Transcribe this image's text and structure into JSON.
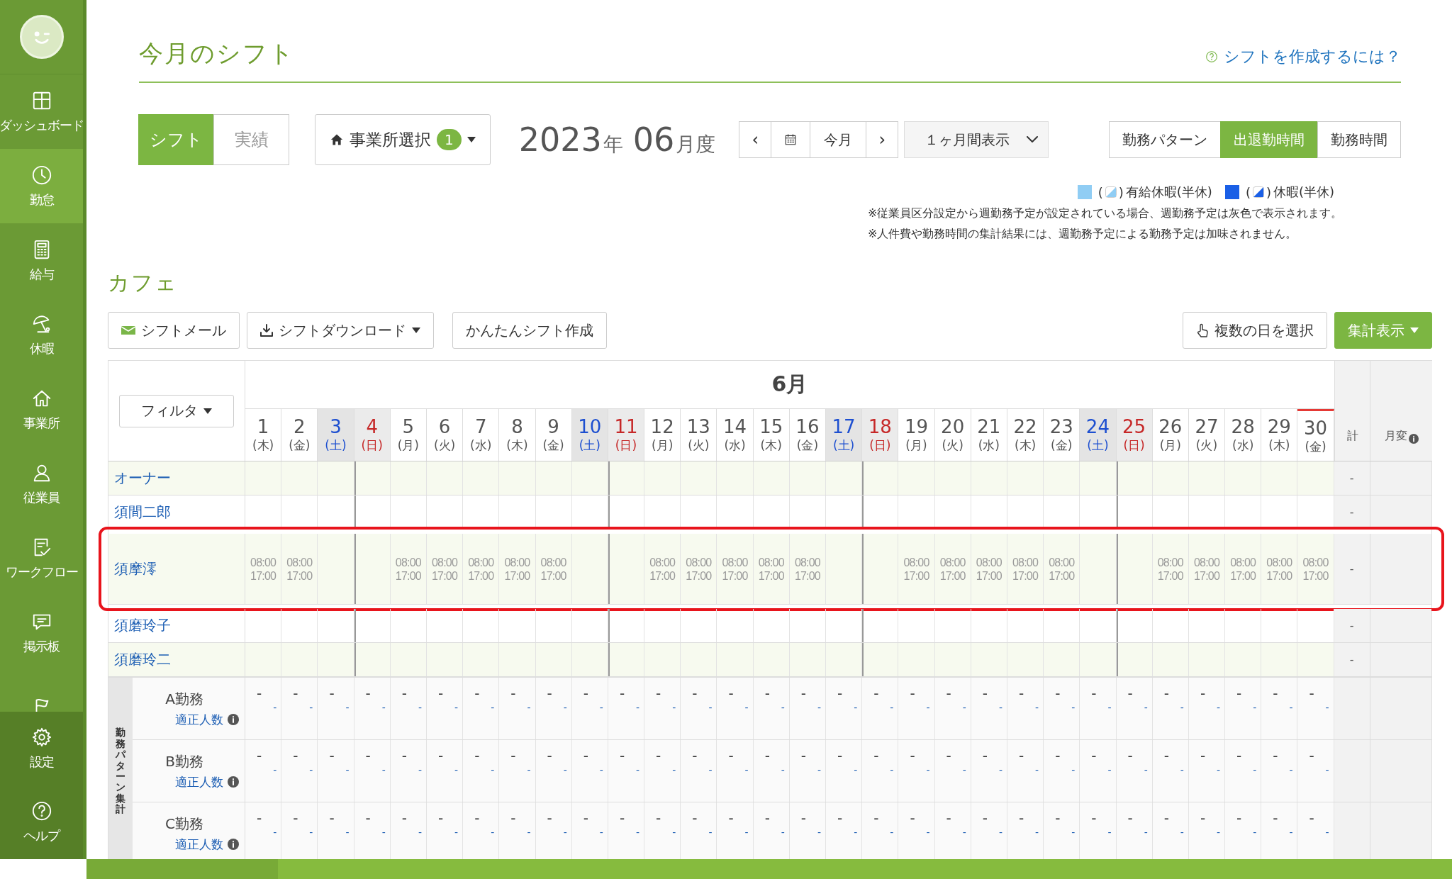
{
  "sidebar": {
    "items": [
      {
        "label": "ダッシュボード",
        "selected": false
      },
      {
        "label": "勤怠",
        "selected": true
      },
      {
        "label": "給与",
        "selected": false
      },
      {
        "label": "休暇",
        "selected": false
      },
      {
        "label": "事業所",
        "selected": false
      },
      {
        "label": "従業員",
        "selected": false
      },
      {
        "label": "ワークフロー",
        "selected": false
      },
      {
        "label": "掲示板",
        "selected": false
      },
      {
        "selected": false
      }
    ],
    "bottom_items": [
      {
        "label": "設定"
      },
      {
        "label": "ヘルプ"
      }
    ]
  },
  "page": {
    "title": "今月のシフト",
    "help_link": "シフトを作成するには？"
  },
  "controls": {
    "mode_tabs": [
      {
        "label": "シフト",
        "selected": true
      },
      {
        "label": "実績",
        "selected": false
      }
    ],
    "office_select": {
      "label": "事業所選択",
      "badge": "1"
    },
    "period": {
      "year": "2023",
      "year_unit": "年",
      "month": "06",
      "month_unit": "月度"
    },
    "nav": {
      "prev": "‹",
      "today": "今月",
      "next": "›"
    },
    "range_select": {
      "value": "１ヶ月間表示"
    },
    "view_tabs": [
      {
        "label": "勤務パターン",
        "selected": false
      },
      {
        "label": "出退勤時間",
        "selected": true
      },
      {
        "label": "勤務時間",
        "selected": false
      }
    ]
  },
  "legend": {
    "items": [
      {
        "color": "#90cdf4",
        "open": "(",
        "close": ")",
        "label": "有給休暇(半休)"
      },
      {
        "color": "#1a5fe6",
        "open": "(",
        "close": ")",
        "label": "休暇(半休)"
      }
    ],
    "notes": [
      "※従業員区分設定から週勤務予定が設定されている場合、週勤務予定は灰色で表示されます。",
      "※人件費や勤務時間の集計結果には、週勤務予定による勤務予定は加味されません。"
    ]
  },
  "section": {
    "title": "カフェ",
    "toolbar": {
      "left": [
        {
          "label": "シフトメール",
          "kind": "mail"
        },
        {
          "label": "シフトダウンロード",
          "kind": "download"
        },
        {
          "label": "かんたんシフト作成",
          "kind": "plain"
        }
      ],
      "right": [
        {
          "label": "複数の日を選択",
          "kind": "hand"
        },
        {
          "label": "集計表示",
          "kind": "primary"
        }
      ]
    }
  },
  "table": {
    "filter": "フィルタ",
    "month": "6月",
    "total_header": "計",
    "change_header": "月変",
    "days": [
      {
        "day": "1",
        "weekday": "(木)",
        "kind": "weekday",
        "today": false
      },
      {
        "day": "2",
        "weekday": "(金)",
        "kind": "weekday",
        "today": false
      },
      {
        "day": "3",
        "weekday": "(土)",
        "kind": "sat",
        "today": false
      },
      {
        "day": "4",
        "weekday": "(日)",
        "kind": "sun",
        "today": false
      },
      {
        "day": "5",
        "weekday": "(月)",
        "kind": "weekday",
        "today": false
      },
      {
        "day": "6",
        "weekday": "(火)",
        "kind": "weekday",
        "today": false
      },
      {
        "day": "7",
        "weekday": "(水)",
        "kind": "weekday",
        "today": false
      },
      {
        "day": "8",
        "weekday": "(木)",
        "kind": "weekday",
        "today": false
      },
      {
        "day": "9",
        "weekday": "(金)",
        "kind": "weekday",
        "today": false
      },
      {
        "day": "10",
        "weekday": "(土)",
        "kind": "sat",
        "today": false
      },
      {
        "day": "11",
        "weekday": "(日)",
        "kind": "sun",
        "today": false
      },
      {
        "day": "12",
        "weekday": "(月)",
        "kind": "weekday",
        "today": false
      },
      {
        "day": "13",
        "weekday": "(火)",
        "kind": "weekday",
        "today": false
      },
      {
        "day": "14",
        "weekday": "(水)",
        "kind": "weekday",
        "today": false
      },
      {
        "day": "15",
        "weekday": "(木)",
        "kind": "weekday",
        "today": false
      },
      {
        "day": "16",
        "weekday": "(金)",
        "kind": "weekday",
        "today": false
      },
      {
        "day": "17",
        "weekday": "(土)",
        "kind": "sat",
        "today": false
      },
      {
        "day": "18",
        "weekday": "(日)",
        "kind": "sun",
        "today": false
      },
      {
        "day": "19",
        "weekday": "(月)",
        "kind": "weekday",
        "today": false
      },
      {
        "day": "20",
        "weekday": "(火)",
        "kind": "weekday",
        "today": false
      },
      {
        "day": "21",
        "weekday": "(水)",
        "kind": "weekday",
        "today": false
      },
      {
        "day": "22",
        "weekday": "(木)",
        "kind": "weekday",
        "today": false
      },
      {
        "day": "23",
        "weekday": "(金)",
        "kind": "weekday",
        "today": false
      },
      {
        "day": "24",
        "weekday": "(土)",
        "kind": "sat",
        "today": false
      },
      {
        "day": "25",
        "weekday": "(日)",
        "kind": "sun",
        "today": false
      },
      {
        "day": "26",
        "weekday": "(月)",
        "kind": "weekday",
        "today": false
      },
      {
        "day": "27",
        "weekday": "(火)",
        "kind": "weekday",
        "today": false
      },
      {
        "day": "28",
        "weekday": "(水)",
        "kind": "weekday",
        "today": false
      },
      {
        "day": "29",
        "weekday": "(木)",
        "kind": "weekday",
        "today": false
      },
      {
        "day": "30",
        "weekday": "(金)",
        "kind": "weekday",
        "today": true
      }
    ],
    "employees": [
      {
        "name": "オーナー",
        "highlighted": false,
        "total": "-"
      },
      {
        "name": "須間二郎",
        "highlighted": false,
        "total": "-"
      },
      {
        "name": "須摩澪",
        "highlighted": true,
        "total": "-",
        "cells": [
          {
            "kind": "shift",
            "start": "08:00",
            "end": "17:00"
          },
          {
            "kind": "shift",
            "start": "08:00",
            "end": "17:00"
          },
          {
            "kind": "blank"
          },
          {
            "kind": "blank"
          },
          {
            "kind": "shift",
            "start": "08:00",
            "end": "17:00"
          },
          {
            "kind": "shift",
            "start": "08:00",
            "end": "17:00"
          },
          {
            "kind": "shift",
            "start": "08:00",
            "end": "17:00"
          },
          {
            "kind": "shift",
            "start": "08:00",
            "end": "17:00"
          },
          {
            "kind": "shift",
            "start": "08:00",
            "end": "17:00"
          },
          {
            "kind": "blank"
          },
          {
            "kind": "blank"
          },
          {
            "kind": "shift",
            "start": "08:00",
            "end": "17:00"
          },
          {
            "kind": "shift",
            "start": "08:00",
            "end": "17:00"
          },
          {
            "kind": "shift",
            "start": "08:00",
            "end": "17:00"
          },
          {
            "kind": "shift",
            "start": "08:00",
            "end": "17:00"
          },
          {
            "kind": "shift",
            "start": "08:00",
            "end": "17:00"
          },
          {
            "kind": "blank"
          },
          {
            "kind": "blank"
          },
          {
            "kind": "shift",
            "start": "08:00",
            "end": "17:00"
          },
          {
            "kind": "shift",
            "start": "08:00",
            "end": "17:00"
          },
          {
            "kind": "shift",
            "start": "08:00",
            "end": "17:00"
          },
          {
            "kind": "shift",
            "start": "08:00",
            "end": "17:00"
          },
          {
            "kind": "shift",
            "start": "08:00",
            "end": "17:00"
          },
          {
            "kind": "blank"
          },
          {
            "kind": "blank"
          },
          {
            "kind": "shift",
            "start": "08:00",
            "end": "17:00"
          },
          {
            "kind": "shift",
            "start": "08:00",
            "end": "17:00"
          },
          {
            "kind": "shift",
            "start": "08:00",
            "end": "17:00"
          },
          {
            "kind": "shift",
            "start": "08:00",
            "end": "17:00"
          },
          {
            "kind": "shift",
            "start": "08:00",
            "end": "17:00"
          }
        ]
      },
      {
        "name": "須磨玲子",
        "highlighted": false,
        "total": "-"
      },
      {
        "name": "須磨玲二",
        "highlighted": false,
        "total": "-"
      }
    ],
    "pattern_summary": {
      "title": "勤務パターン集計",
      "rows": [
        {
          "name": "A勤務",
          "sub_label": "適正人数",
          "counts": [
            "-",
            "-",
            "-",
            "-",
            "-",
            "-",
            "-",
            "-",
            "-",
            "-",
            "-",
            "-",
            "-",
            "-",
            "-",
            "-",
            "-",
            "-",
            "-",
            "-",
            "-",
            "-",
            "-",
            "-",
            "-",
            "-",
            "-",
            "-",
            "-",
            "-"
          ],
          "proper": [
            "-",
            "-",
            "-",
            "-",
            "-",
            "-",
            "-",
            "-",
            "-",
            "-",
            "-",
            "-",
            "-",
            "-",
            "-",
            "-",
            "-",
            "-",
            "-",
            "-",
            "-",
            "-",
            "-",
            "-",
            "-",
            "-",
            "-",
            "-",
            "-",
            "-"
          ]
        },
        {
          "name": "B勤務",
          "sub_label": "適正人数",
          "counts": [
            "-",
            "-",
            "-",
            "-",
            "-",
            "-",
            "-",
            "-",
            "-",
            "-",
            "-",
            "-",
            "-",
            "-",
            "-",
            "-",
            "-",
            "-",
            "-",
            "-",
            "-",
            "-",
            "-",
            "-",
            "-",
            "-",
            "-",
            "-",
            "-",
            "-"
          ],
          "proper": [
            "-",
            "-",
            "-",
            "-",
            "-",
            "-",
            "-",
            "-",
            "-",
            "-",
            "-",
            "-",
            "-",
            "-",
            "-",
            "-",
            "-",
            "-",
            "-",
            "-",
            "-",
            "-",
            "-",
            "-",
            "-",
            "-",
            "-",
            "-",
            "-",
            "-"
          ]
        },
        {
          "name": "C勤務",
          "sub_label": "適正人数",
          "counts": [
            "-",
            "-",
            "-",
            "-",
            "-",
            "-",
            "-",
            "-",
            "-",
            "-",
            "-",
            "-",
            "-",
            "-",
            "-",
            "-",
            "-",
            "-",
            "-",
            "-",
            "-",
            "-",
            "-",
            "-",
            "-",
            "-",
            "-",
            "-",
            "-",
            "-"
          ],
          "proper": [
            "-",
            "-",
            "-",
            "-",
            "-",
            "-",
            "-",
            "-",
            "-",
            "-",
            "-",
            "-",
            "-",
            "-",
            "-",
            "-",
            "-",
            "-",
            "-",
            "-",
            "-",
            "-",
            "-",
            "-",
            "-",
            "-",
            "-",
            "-",
            "-",
            "-"
          ]
        }
      ]
    }
  }
}
